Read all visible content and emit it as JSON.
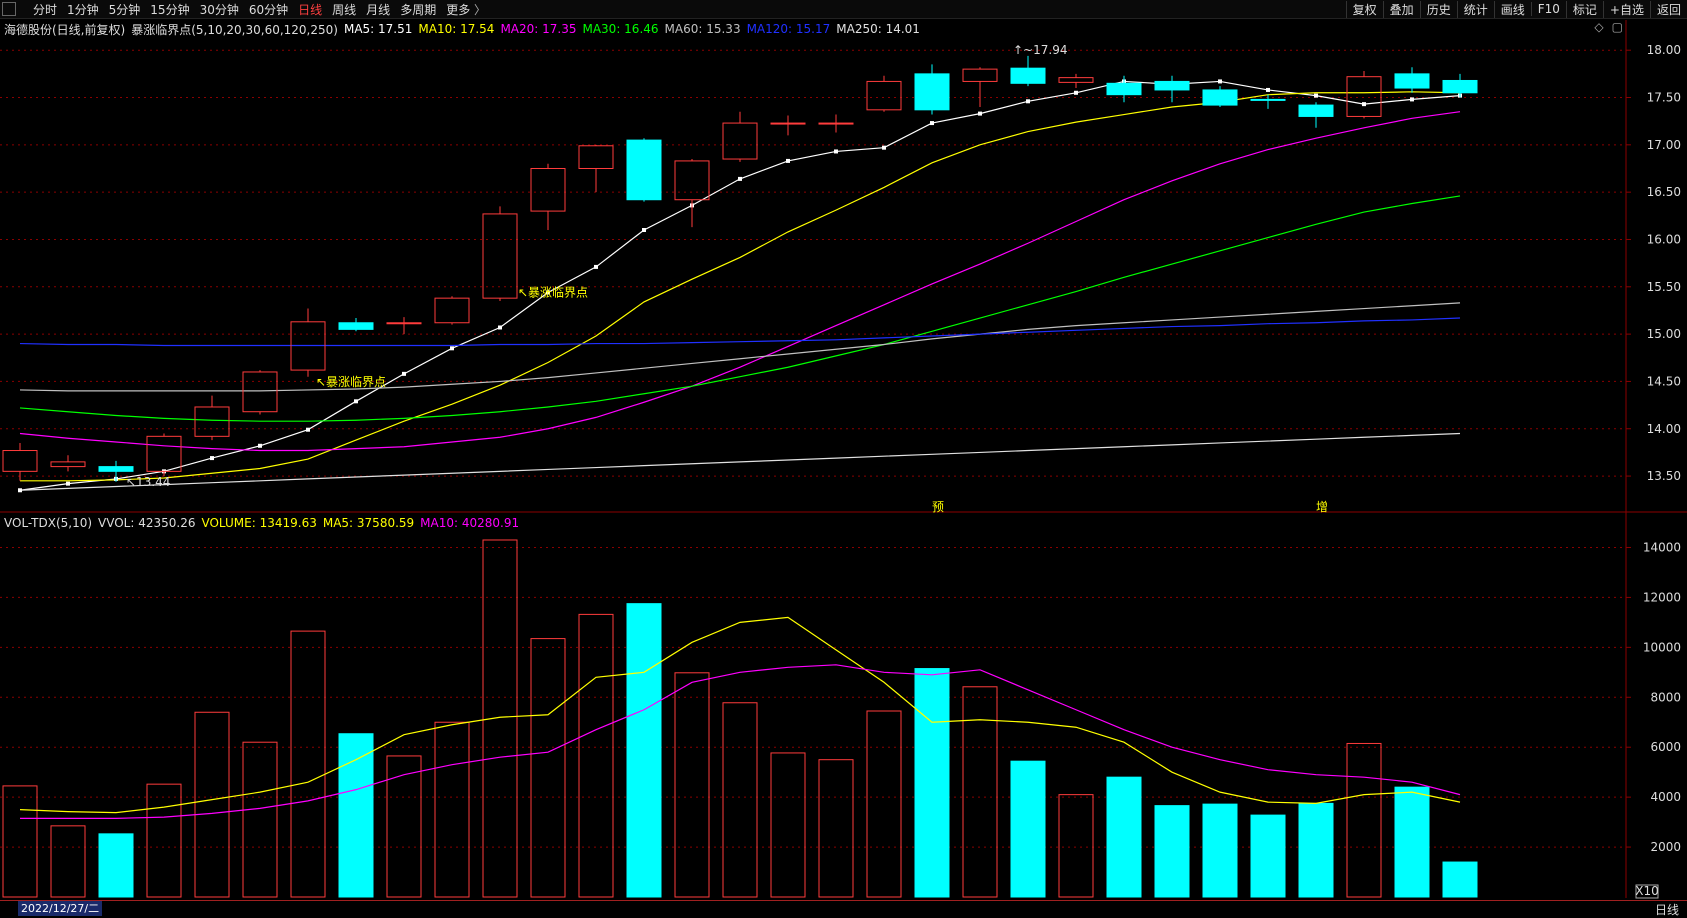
{
  "toolbar": {
    "periods": [
      "分时",
      "1分钟",
      "5分钟",
      "15分钟",
      "30分钟",
      "60分钟",
      "日线",
      "周线",
      "月线",
      "多周期",
      "更多"
    ],
    "active_period": "日线",
    "tools": [
      "复权",
      "叠加",
      "历史",
      "统计",
      "画线",
      "F10",
      "标记",
      "+自选",
      "返回"
    ]
  },
  "main_header": {
    "stock": "海德股份(日线,前复权)",
    "indicator": "暴涨临界点(5,10,20,30,60,120,250)",
    "ma5": "MA5: 17.51",
    "ma10": "MA10: 17.54",
    "ma20": "MA20: 17.35",
    "ma30": "MA30: 16.46",
    "ma60": "MA60: 15.33",
    "ma120": "MA120: 15.17",
    "ma250": "MA250: 14.01"
  },
  "vol_header": {
    "name": "VOL-TDX(5,10)",
    "vvol": "VVOL: 42350.26",
    "volume": "VOLUME: 13419.63",
    "ma5": "MA5: 37580.59",
    "ma10": "MA10: 40280.91"
  },
  "colors": {
    "up": "#ff3c3c",
    "down": "#00ffff",
    "ma5": "#ffffff",
    "ma10": "#ffff00",
    "ma20": "#ff00ff",
    "ma30": "#00ff00",
    "ma60": "#c0c0c0",
    "ma120": "#2030ff",
    "ma250": "#e0e0e0",
    "grid": "#8b0000",
    "label": "#ffff00"
  },
  "bottom": {
    "date": "2022/12/27/二",
    "period": "日线",
    "marks": [
      "1",
      "2"
    ],
    "xscale": "X10"
  },
  "annotations": {
    "high": "17.94",
    "low": "13.44",
    "signal_label": "暴涨临界点",
    "tag1": "预",
    "tag2": "增"
  },
  "chart_data": [
    {
      "type": "candlestick",
      "y_ticks": [
        13.5,
        14.0,
        14.5,
        15.0,
        15.5,
        16.0,
        16.5,
        17.0,
        17.5,
        18.0
      ],
      "ylim": [
        13.3,
        18.15
      ],
      "candles": [
        {
          "o": 13.55,
          "h": 13.85,
          "l": 13.45,
          "c": 13.77
        },
        {
          "o": 13.6,
          "h": 13.72,
          "l": 13.55,
          "c": 13.65
        },
        {
          "o": 13.6,
          "h": 13.66,
          "l": 13.44,
          "c": 13.55
        },
        {
          "o": 13.55,
          "h": 13.95,
          "l": 13.5,
          "c": 13.92
        },
        {
          "o": 13.92,
          "h": 14.35,
          "l": 13.88,
          "c": 14.23
        },
        {
          "o": 14.18,
          "h": 14.62,
          "l": 14.15,
          "c": 14.6
        },
        {
          "o": 14.62,
          "h": 15.27,
          "l": 14.55,
          "c": 15.13
        },
        {
          "o": 15.12,
          "h": 15.17,
          "l": 15.03,
          "c": 15.05
        },
        {
          "o": 15.12,
          "h": 15.18,
          "l": 15.0,
          "c": 15.12
        },
        {
          "o": 15.12,
          "h": 15.4,
          "l": 15.1,
          "c": 15.38
        },
        {
          "o": 15.38,
          "h": 16.35,
          "l": 15.35,
          "c": 16.27
        },
        {
          "o": 16.3,
          "h": 16.8,
          "l": 16.1,
          "c": 16.75
        },
        {
          "o": 16.75,
          "h": 17.0,
          "l": 16.5,
          "c": 16.99
        },
        {
          "o": 17.05,
          "h": 17.07,
          "l": 16.4,
          "c": 16.42
        },
        {
          "o": 16.42,
          "h": 16.85,
          "l": 16.13,
          "c": 16.83
        },
        {
          "o": 16.85,
          "h": 17.35,
          "l": 16.82,
          "c": 17.23
        },
        {
          "o": 17.23,
          "h": 17.31,
          "l": 17.1,
          "c": 17.23
        },
        {
          "o": 17.23,
          "h": 17.32,
          "l": 17.13,
          "c": 17.23
        },
        {
          "o": 17.37,
          "h": 17.73,
          "l": 17.35,
          "c": 17.67
        },
        {
          "o": 17.75,
          "h": 17.85,
          "l": 17.32,
          "c": 17.37
        },
        {
          "o": 17.67,
          "h": 17.82,
          "l": 17.4,
          "c": 17.8
        },
        {
          "o": 17.81,
          "h": 17.94,
          "l": 17.62,
          "c": 17.65
        },
        {
          "o": 17.66,
          "h": 17.75,
          "l": 17.6,
          "c": 17.71
        },
        {
          "o": 17.65,
          "h": 17.73,
          "l": 17.45,
          "c": 17.53
        },
        {
          "o": 17.67,
          "h": 17.73,
          "l": 17.45,
          "c": 17.58
        },
        {
          "o": 17.58,
          "h": 17.62,
          "l": 17.4,
          "c": 17.42
        },
        {
          "o": 17.48,
          "h": 17.53,
          "l": 17.38,
          "c": 17.47
        },
        {
          "o": 17.42,
          "h": 17.45,
          "l": 17.18,
          "c": 17.3
        },
        {
          "o": 17.3,
          "h": 17.78,
          "l": 17.28,
          "c": 17.72
        },
        {
          "o": 17.75,
          "h": 17.82,
          "l": 17.55,
          "c": 17.6
        },
        {
          "o": 17.68,
          "h": 17.75,
          "l": 17.5,
          "c": 17.55
        }
      ],
      "series": [
        {
          "name": "MA5",
          "values": [
            13.35,
            13.42,
            13.47,
            13.55,
            13.69,
            13.82,
            13.99,
            14.29,
            14.58,
            14.85,
            15.07,
            15.44,
            15.71,
            16.1,
            16.36,
            16.64,
            16.83,
            16.93,
            16.97,
            17.23,
            17.33,
            17.46,
            17.55,
            17.67,
            17.64,
            17.67,
            17.58,
            17.52,
            17.43,
            17.48,
            17.52
          ]
        },
        {
          "name": "MA10",
          "values": [
            13.45,
            13.45,
            13.46,
            13.48,
            13.53,
            13.58,
            13.68,
            13.88,
            14.08,
            14.26,
            14.46,
            14.7,
            14.98,
            15.34,
            15.58,
            15.81,
            16.08,
            16.31,
            16.55,
            16.81,
            17.0,
            17.14,
            17.24,
            17.32,
            17.4,
            17.45,
            17.53,
            17.55,
            17.55,
            17.56,
            17.55
          ]
        },
        {
          "name": "MA20",
          "values": [
            13.95,
            13.9,
            13.86,
            13.82,
            13.79,
            13.77,
            13.77,
            13.79,
            13.81,
            13.86,
            13.91,
            14.0,
            14.12,
            14.28,
            14.45,
            14.65,
            14.87,
            15.09,
            15.31,
            15.53,
            15.74,
            15.96,
            16.19,
            16.42,
            16.62,
            16.8,
            16.95,
            17.07,
            17.18,
            17.28,
            17.35
          ]
        },
        {
          "name": "MA30",
          "values": [
            14.22,
            14.18,
            14.14,
            14.11,
            14.09,
            14.08,
            14.08,
            14.09,
            14.11,
            14.14,
            14.18,
            14.23,
            14.29,
            14.37,
            14.45,
            14.55,
            14.65,
            14.77,
            14.89,
            15.03,
            15.17,
            15.31,
            15.45,
            15.6,
            15.74,
            15.88,
            16.02,
            16.16,
            16.29,
            16.38,
            16.46
          ]
        },
        {
          "name": "MA60",
          "values": [
            14.41,
            14.4,
            14.4,
            14.4,
            14.4,
            14.4,
            14.41,
            14.42,
            14.44,
            14.47,
            14.5,
            14.54,
            14.59,
            14.64,
            14.69,
            14.74,
            14.79,
            14.84,
            14.89,
            14.95,
            15.0,
            15.05,
            15.09,
            15.12,
            15.15,
            15.18,
            15.21,
            15.24,
            15.27,
            15.3,
            15.33
          ]
        },
        {
          "name": "MA120",
          "values": [
            14.9,
            14.89,
            14.89,
            14.88,
            14.88,
            14.88,
            14.88,
            14.88,
            14.88,
            14.88,
            14.89,
            14.89,
            14.9,
            14.9,
            14.91,
            14.92,
            14.93,
            14.94,
            14.96,
            14.98,
            15.0,
            15.02,
            15.04,
            15.06,
            15.08,
            15.09,
            15.11,
            15.12,
            15.14,
            15.15,
            15.17
          ]
        },
        {
          "name": "MA250",
          "values": [
            13.35,
            13.37,
            13.39,
            13.41,
            13.43,
            13.45,
            13.47,
            13.49,
            13.51,
            13.53,
            13.55,
            13.57,
            13.59,
            13.61,
            13.63,
            13.65,
            13.67,
            13.69,
            13.71,
            13.73,
            13.75,
            13.77,
            13.79,
            13.81,
            13.83,
            13.85,
            13.87,
            13.89,
            13.91,
            13.93,
            13.95,
            14.01
          ]
        }
      ]
    },
    {
      "type": "bar",
      "y_ticks": [
        2000,
        4000,
        6000,
        8000,
        10000,
        12000,
        14000
      ],
      "ylim": [
        0,
        14700
      ],
      "values": [
        4450,
        2850,
        2530,
        4520,
        7400,
        6200,
        10650,
        6540,
        5650,
        7000,
        14300,
        10350,
        11320,
        11750,
        8980,
        7780,
        5770,
        5500,
        7450,
        9150,
        8420,
        5440,
        4100,
        4800,
        3660,
        3720,
        3280,
        3750,
        6150,
        4400,
        1400
      ],
      "ma5": [
        3500,
        3420,
        3380,
        3600,
        3900,
        4200,
        4600,
        5500,
        6500,
        6900,
        7200,
        7300,
        8800,
        9000,
        10200,
        11000,
        11200,
        9900,
        8600,
        7000,
        7100,
        7000,
        6800,
        6200,
        5000,
        4200,
        3800,
        3750,
        4100,
        4200,
        3800
      ],
      "ma10": [
        3150,
        3150,
        3150,
        3200,
        3350,
        3550,
        3850,
        4300,
        4900,
        5300,
        5600,
        5800,
        6700,
        7500,
        8600,
        9000,
        9200,
        9300,
        9000,
        8900,
        9100,
        8300,
        7500,
        6700,
        6000,
        5500,
        5100,
        4900,
        4800,
        4600,
        4100
      ]
    }
  ]
}
